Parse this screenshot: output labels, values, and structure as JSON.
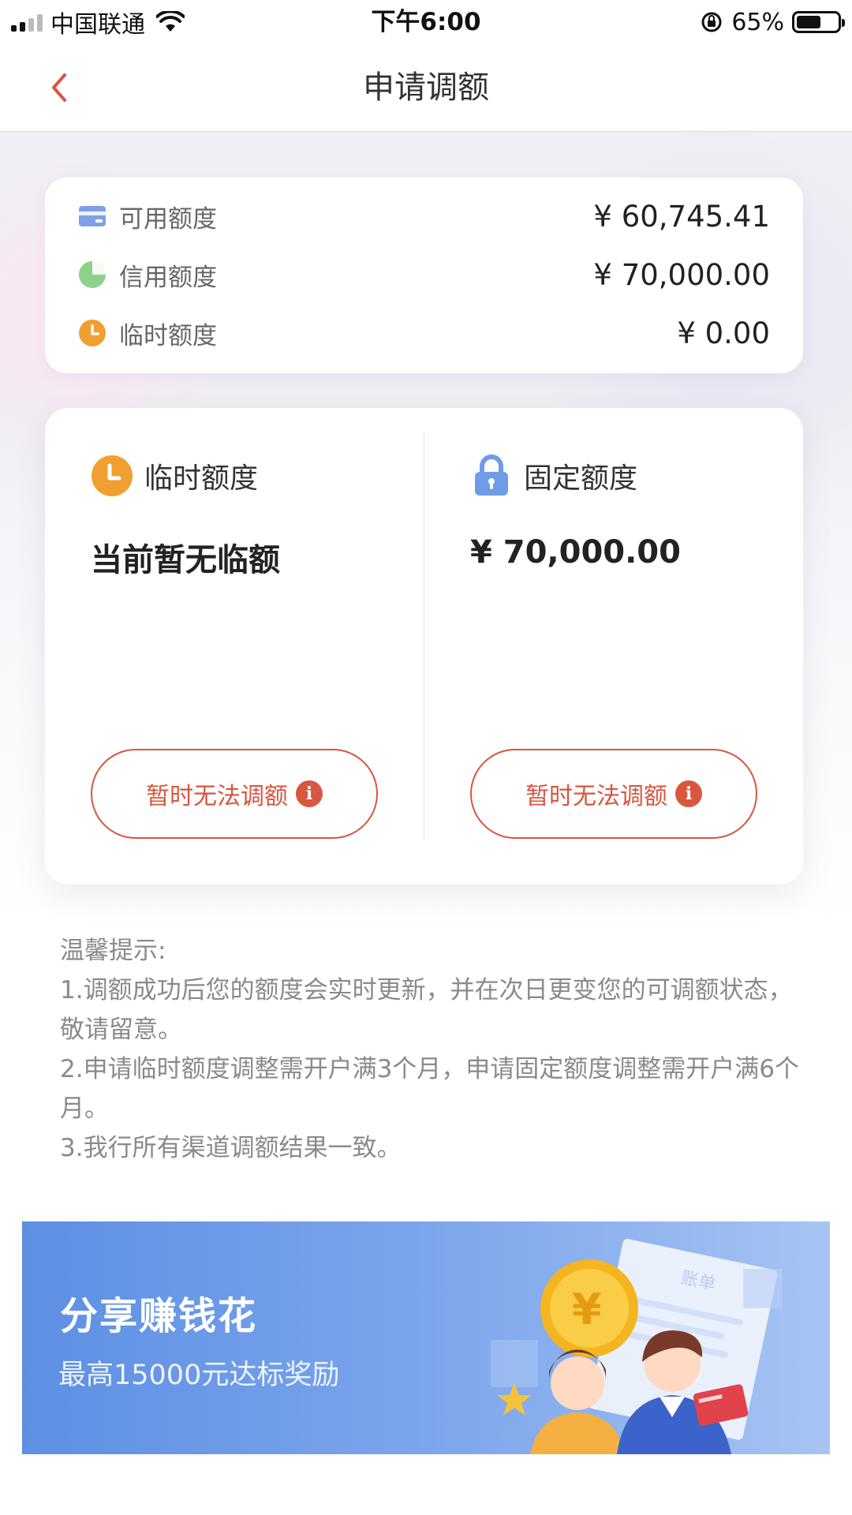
{
  "status_bar": {
    "carrier": "中国联通",
    "time": "下午6:00",
    "battery_percent": "65%"
  },
  "nav": {
    "title": "申请调额"
  },
  "summary": {
    "rows": [
      {
        "label": "可用额度",
        "value": "¥ 60,745.41",
        "icon": "card-icon",
        "icon_color": "#7fa0e6"
      },
      {
        "label": "信用额度",
        "value": "¥ 70,000.00",
        "icon": "pie-icon",
        "icon_color": "#8fd18a"
      },
      {
        "label": "临时额度",
        "value": "¥ 0.00",
        "icon": "clock-icon",
        "icon_color": "#f0a030"
      }
    ]
  },
  "cards": {
    "temporary": {
      "title": "临时额度",
      "amount": "当前暂无临额",
      "button_label": "暂时无法调额",
      "info_glyph": "i"
    },
    "fixed": {
      "title": "固定额度",
      "amount": "¥ 70,000.00",
      "button_label": "暂时无法调额",
      "info_glyph": "i"
    }
  },
  "tips": {
    "heading": "温馨提示:",
    "items": [
      "1.调额成功后您的额度会实时更新，并在次日更变您的可调额状态，敬请留意。",
      "2.申请临时额度调整需开户满3个月，申请固定额度调整需开户满6个月。",
      "3.我行所有渠道调额结果一致。"
    ]
  },
  "banner": {
    "title": "分享赚钱花",
    "subtitle": "最高15000元达标奖励",
    "art_card_text": "账单"
  },
  "colors": {
    "accent_red": "#d7563f",
    "orange": "#f0a030",
    "lock_blue": "#6f9be9",
    "banner_blue": "#5d8fe3"
  }
}
